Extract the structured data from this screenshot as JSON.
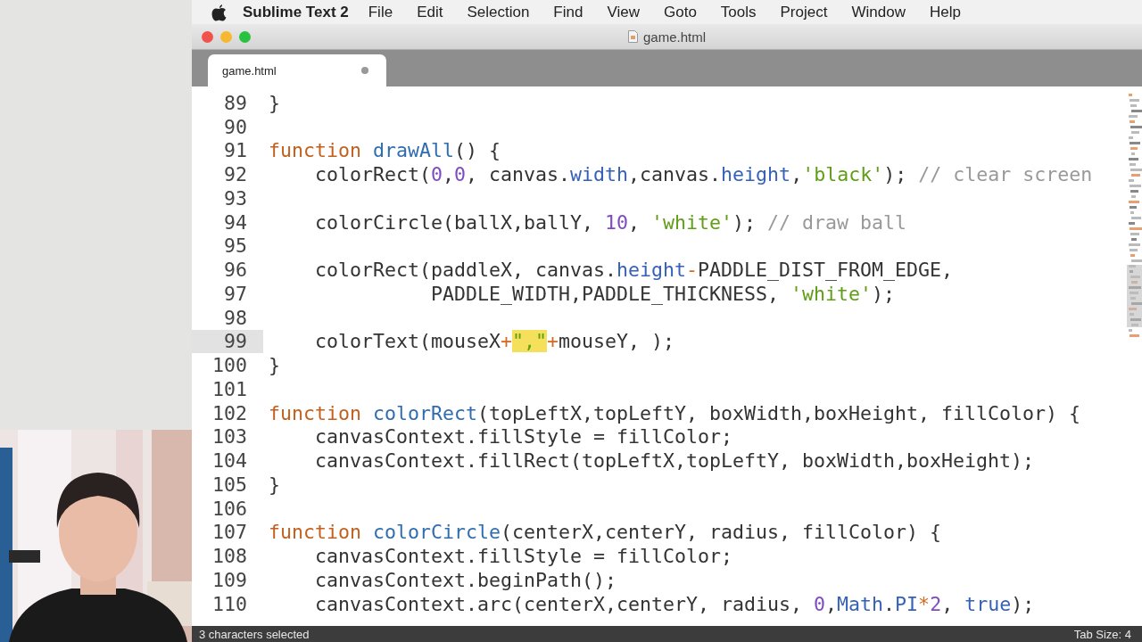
{
  "menu_bar": {
    "app_name": "Sublime Text 2",
    "items": [
      "File",
      "Edit",
      "Selection",
      "Find",
      "View",
      "Goto",
      "Tools",
      "Project",
      "Window",
      "Help"
    ]
  },
  "window": {
    "title": "game.html"
  },
  "tabs": [
    {
      "label": "game.html",
      "selected": true,
      "modified": true
    }
  ],
  "editor": {
    "lines": [
      {
        "number": "89",
        "current": false,
        "tokens": [
          {
            "kind": "plain",
            "text": "}"
          }
        ]
      },
      {
        "number": "90",
        "current": false
      },
      {
        "number": "91",
        "current": false,
        "tokens": [
          {
            "kind": "keyword",
            "text": "function "
          },
          {
            "kind": "entity",
            "text": "drawAll"
          },
          {
            "kind": "plain",
            "text": "() {"
          }
        ]
      },
      {
        "number": "92",
        "current": false,
        "tokens": [
          {
            "kind": "plain",
            "text": "    colorRect("
          },
          {
            "kind": "number",
            "text": "0"
          },
          {
            "kind": "plain",
            "text": ","
          },
          {
            "kind": "number",
            "text": "0"
          },
          {
            "kind": "plain",
            "text": ", canvas."
          },
          {
            "kind": "support",
            "text": "width"
          },
          {
            "kind": "plain",
            "text": ",canvas."
          },
          {
            "kind": "support",
            "text": "height"
          },
          {
            "kind": "plain",
            "text": ","
          },
          {
            "kind": "string",
            "text": "'black'"
          },
          {
            "kind": "plain",
            "text": "); "
          },
          {
            "kind": "comment",
            "text": "// clear screen"
          }
        ]
      },
      {
        "number": "93",
        "current": false
      },
      {
        "number": "94",
        "current": false,
        "tokens": [
          {
            "kind": "plain",
            "text": "    colorCircle(ballX,ballY, "
          },
          {
            "kind": "number",
            "text": "10"
          },
          {
            "kind": "plain",
            "text": ", "
          },
          {
            "kind": "string",
            "text": "'white'"
          },
          {
            "kind": "plain",
            "text": "); "
          },
          {
            "kind": "comment",
            "text": "// draw ball"
          }
        ]
      },
      {
        "number": "95",
        "current": false
      },
      {
        "number": "96",
        "current": false,
        "tokens": [
          {
            "kind": "plain",
            "text": "    colorRect(paddleX, canvas."
          },
          {
            "kind": "support",
            "text": "height"
          },
          {
            "kind": "operator",
            "text": "-"
          },
          {
            "kind": "plain",
            "text": "PADDLE_DIST_FROM_EDGE,"
          }
        ]
      },
      {
        "number": "97",
        "current": false,
        "tokens": [
          {
            "kind": "plain",
            "text": "              PADDLE_WIDTH,PADDLE_THICKNESS, "
          },
          {
            "kind": "string",
            "text": "'white'"
          },
          {
            "kind": "plain",
            "text": ");"
          }
        ]
      },
      {
        "number": "98",
        "current": false
      },
      {
        "number": "99",
        "current": true,
        "tokens": [
          {
            "kind": "plain",
            "text": "    colorText(mouseX"
          },
          {
            "kind": "operator",
            "text": "+"
          },
          {
            "kind": "selection",
            "text": "\",\""
          },
          {
            "kind": "operator",
            "text": "+"
          },
          {
            "kind": "plain",
            "text": "mouseY, );"
          }
        ]
      },
      {
        "number": "100",
        "current": false,
        "tokens": [
          {
            "kind": "plain",
            "text": "}"
          }
        ]
      },
      {
        "number": "101",
        "current": false
      },
      {
        "number": "102",
        "current": false,
        "tokens": [
          {
            "kind": "keyword",
            "text": "function "
          },
          {
            "kind": "entity",
            "text": "colorRect"
          },
          {
            "kind": "plain",
            "text": "(topLeftX,topLeftY, boxWidth,boxHeight, fillColor) {"
          }
        ]
      },
      {
        "number": "103",
        "current": false,
        "tokens": [
          {
            "kind": "plain",
            "text": "    canvasContext.fillStyle = fillColor;"
          }
        ]
      },
      {
        "number": "104",
        "current": false,
        "tokens": [
          {
            "kind": "plain",
            "text": "    canvasContext.fillRect(topLeftX,topLeftY, boxWidth,boxHeight);"
          }
        ]
      },
      {
        "number": "105",
        "current": false,
        "tokens": [
          {
            "kind": "plain",
            "text": "}"
          }
        ]
      },
      {
        "number": "106",
        "current": false
      },
      {
        "number": "107",
        "current": false,
        "tokens": [
          {
            "kind": "keyword",
            "text": "function "
          },
          {
            "kind": "entity",
            "text": "colorCircle"
          },
          {
            "kind": "plain",
            "text": "(centerX,centerY, radius, fillColor) {"
          }
        ]
      },
      {
        "number": "108",
        "current": false,
        "tokens": [
          {
            "kind": "plain",
            "text": "    canvasContext.fillStyle = fillColor;"
          }
        ]
      },
      {
        "number": "109",
        "current": false,
        "tokens": [
          {
            "kind": "plain",
            "text": "    canvasContext.beginPath();"
          }
        ]
      },
      {
        "number": "110",
        "current": false,
        "tokens": [
          {
            "kind": "plain",
            "text": "    canvasContext.arc(centerX,centerY, radius, "
          },
          {
            "kind": "number",
            "text": "0"
          },
          {
            "kind": "plain",
            "text": ","
          },
          {
            "kind": "support",
            "text": "Math"
          },
          {
            "kind": "plain",
            "text": "."
          },
          {
            "kind": "support",
            "text": "PI"
          },
          {
            "kind": "operator",
            "text": "*"
          },
          {
            "kind": "number",
            "text": "2"
          },
          {
            "kind": "plain",
            "text": ", "
          },
          {
            "kind": "support",
            "text": "true"
          },
          {
            "kind": "plain",
            "text": ");"
          }
        ]
      }
    ]
  },
  "status_bar": {
    "selection": "3 characters selected",
    "tab_size": "Tab Size: 4"
  }
}
